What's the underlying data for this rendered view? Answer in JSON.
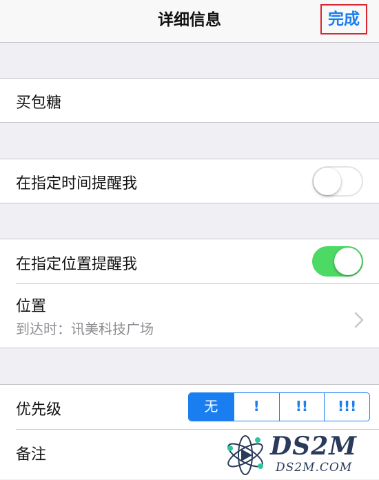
{
  "navbar": {
    "title": "详细信息",
    "done_label": "完成"
  },
  "task": {
    "title": "买包糖"
  },
  "remind_time": {
    "label": "在指定时间提醒我",
    "enabled": false
  },
  "remind_location": {
    "label": "在指定位置提醒我",
    "enabled": true,
    "location_label": "位置",
    "location_value": "到达时：讯美科技广场"
  },
  "priority": {
    "label": "优先级",
    "options": [
      "无",
      "!",
      "!!",
      "!!!"
    ],
    "selected": "无"
  },
  "notes": {
    "label": "备注"
  },
  "watermark": {
    "brand": "DS2M",
    "domain": "DS2M.COM"
  },
  "colors": {
    "accent": "#1a7ef0",
    "toggle_on": "#4cd964",
    "highlight_border": "#d9262f"
  }
}
